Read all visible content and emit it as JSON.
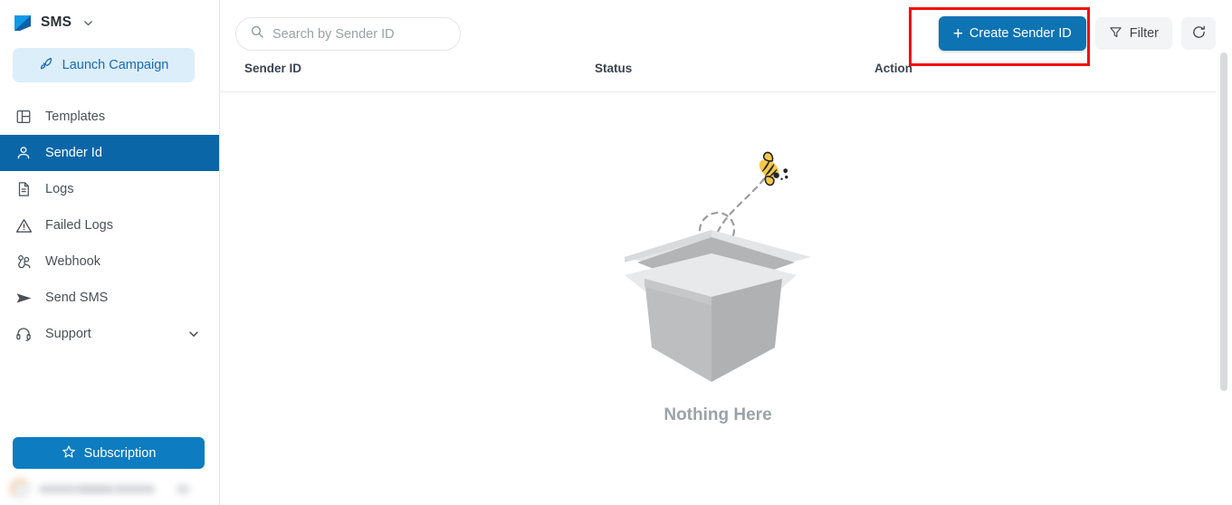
{
  "sidebar": {
    "brand": {
      "title": "SMS",
      "logo_icon": "speech-bubble-icon",
      "chevron_icon": "chevron-down-icon"
    },
    "launch": {
      "label": "Launch Campaign",
      "icon": "rocket-icon"
    },
    "items": [
      {
        "label": "Templates",
        "icon": "layout-template-icon",
        "active": false,
        "expandable": false
      },
      {
        "label": "Sender Id",
        "icon": "user-icon",
        "active": true,
        "expandable": false
      },
      {
        "label": "Logs",
        "icon": "file-text-icon",
        "active": false,
        "expandable": false
      },
      {
        "label": "Failed Logs",
        "icon": "alert-triangle-icon",
        "active": false,
        "expandable": false
      },
      {
        "label": "Webhook",
        "icon": "webhook-icon",
        "active": false,
        "expandable": false
      },
      {
        "label": "Send SMS",
        "icon": "send-icon",
        "active": false,
        "expandable": false
      },
      {
        "label": "Support",
        "icon": "headset-icon",
        "active": false,
        "expandable": true
      }
    ],
    "subscription": {
      "label": "Subscription",
      "icon": "star-icon"
    },
    "profile": {
      "redacted": true
    }
  },
  "toolbar": {
    "search": {
      "placeholder": "Search by Sender ID",
      "value": "",
      "icon": "search-icon"
    },
    "create_button": {
      "label": "Create Sender ID",
      "icon": "plus-icon"
    },
    "filter_button": {
      "label": "Filter",
      "icon": "funnel-icon"
    },
    "refresh_button": {
      "icon": "refresh-icon"
    }
  },
  "table": {
    "columns": [
      "Sender ID",
      "Status",
      "Action"
    ],
    "rows": []
  },
  "empty_state": {
    "message": "Nothing Here",
    "illustration": "empty-box-with-bee-illustration"
  },
  "annotation": {
    "type": "highlight-rectangle",
    "color": "#f50c0c",
    "target": "create-sender-id-button"
  },
  "colors": {
    "accent_blue": "#0d73b3",
    "sidebar_active": "#0b66a8",
    "launch_bg": "#ddeefb",
    "subscription_blue": "#0d7cc0",
    "highlight_red": "#f50c0c",
    "bee_yellow": "#f5c councils"
  },
  "scrollbar": {
    "orientation": "vertical",
    "position": "right"
  }
}
